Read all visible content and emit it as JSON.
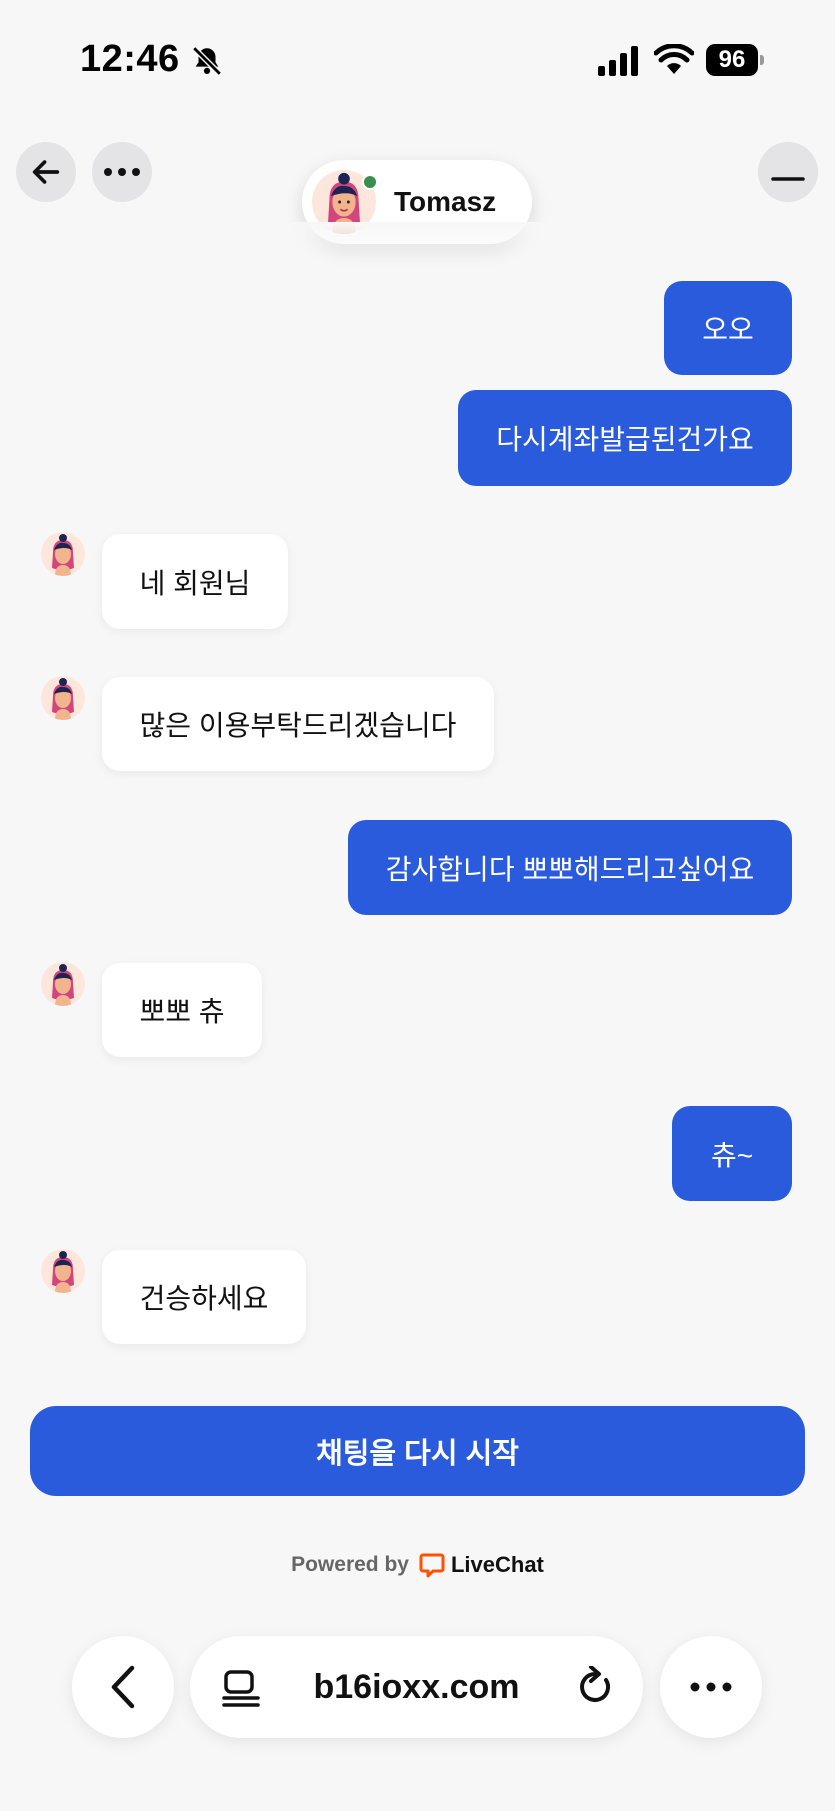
{
  "status_bar": {
    "time": "12:46",
    "battery": "96"
  },
  "header": {
    "agent_name": "Tomasz"
  },
  "messages": [
    {
      "dir": "out",
      "text": "오오"
    },
    {
      "dir": "out",
      "text": "다시계좌발급된건가요"
    },
    {
      "dir": "in",
      "text": "네 회원님"
    },
    {
      "dir": "in",
      "text": "많은 이용부탁드리겠습니다"
    },
    {
      "dir": "out",
      "text": "감사합니다 뽀뽀해드리고싶어요"
    },
    {
      "dir": "in",
      "text": "뽀뽀 츄"
    },
    {
      "dir": "out",
      "text": "츄~"
    },
    {
      "dir": "in",
      "text": "건승하세요"
    }
  ],
  "restart_label": "채팅을 다시 시작",
  "powered": {
    "label": "Powered by",
    "brand": "LiveChat"
  },
  "browser": {
    "url": "b16ioxx.com"
  },
  "colors": {
    "accent": "#2a5bdc",
    "online": "#3a8f4e",
    "livechat": "#ff5100"
  },
  "icons": [
    "bell-off-icon",
    "signal-icon",
    "wifi-icon",
    "battery-icon",
    "back-arrow-icon",
    "more-dots-icon",
    "minimize-icon",
    "livechat-logo-icon",
    "chevron-left-icon",
    "tabs-icon",
    "reload-icon"
  ]
}
